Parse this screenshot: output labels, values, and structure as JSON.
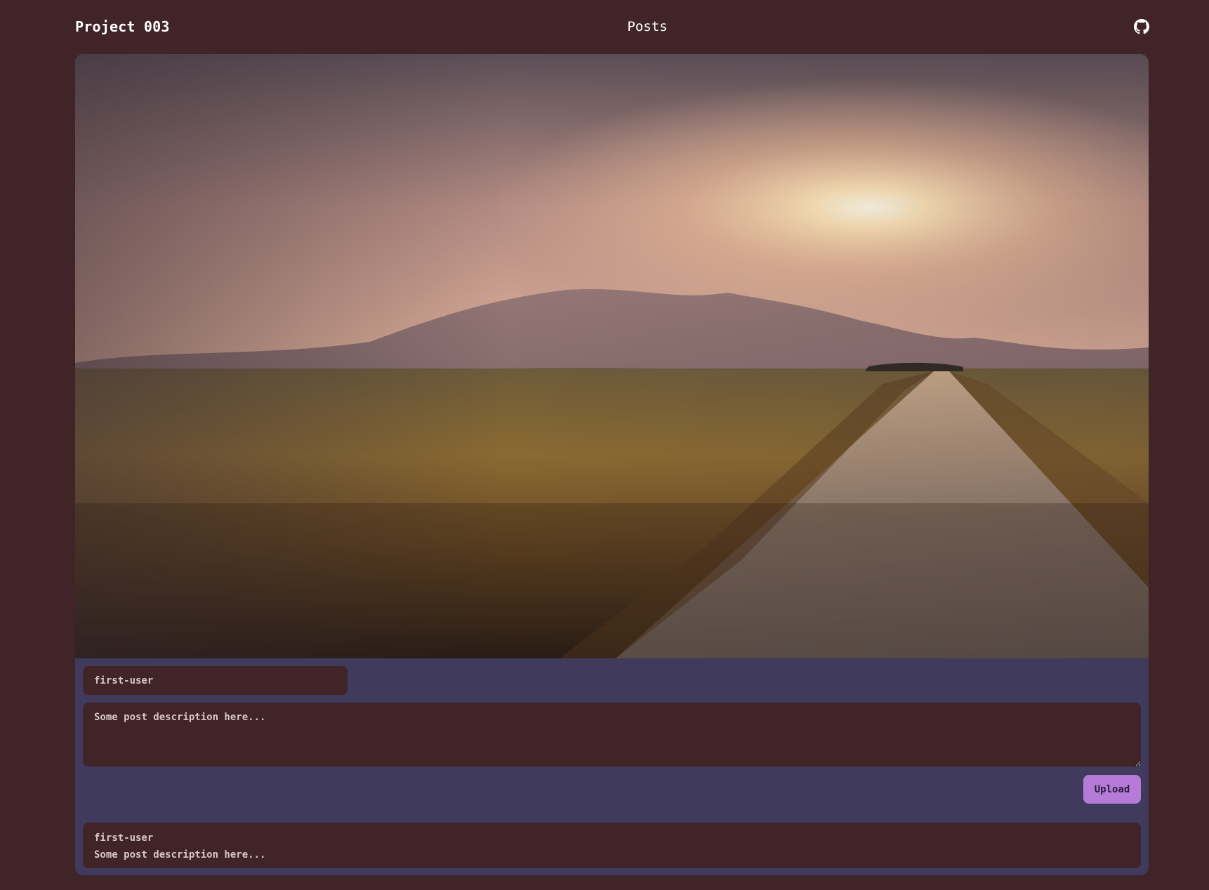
{
  "header": {
    "brand": "Project 003",
    "nav_posts": "Posts",
    "github_icon": "github-icon"
  },
  "form": {
    "username_value": "first-user",
    "description_placeholder": "Some post description here...",
    "upload_label": "Upload"
  },
  "posts": [
    {
      "user": "first-user",
      "description": "Some post description here..."
    }
  ],
  "colors": {
    "page_bg": "#402427",
    "card_bg": "#403a5c",
    "accent": "#b67ad9"
  }
}
